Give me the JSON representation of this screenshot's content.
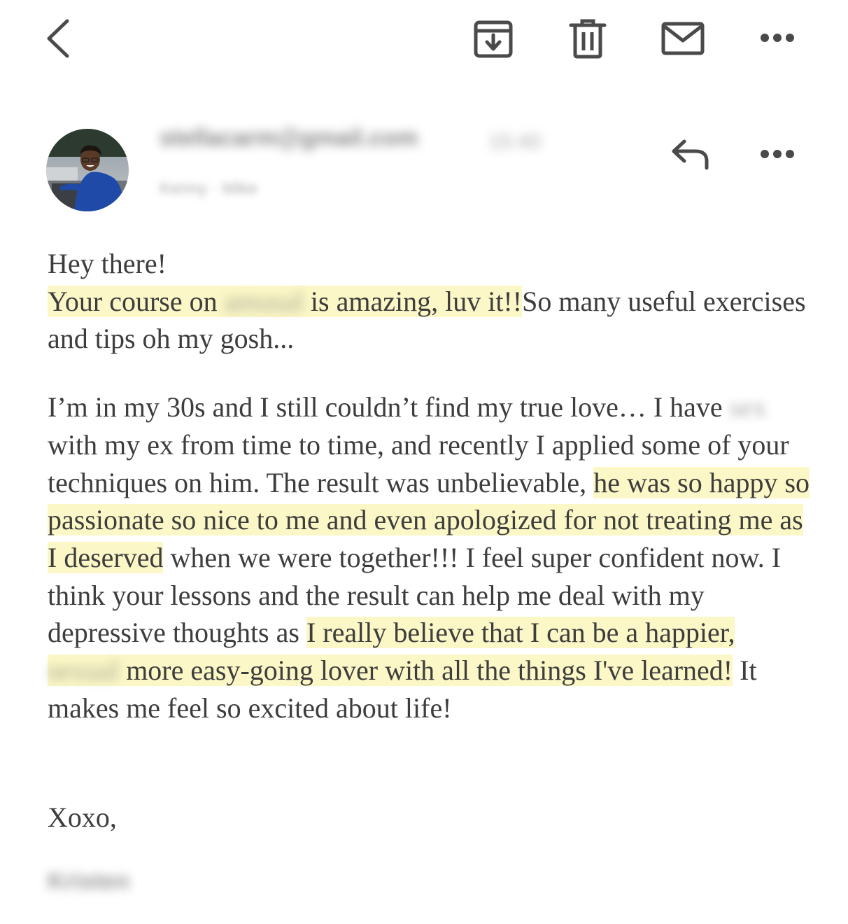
{
  "toolbar": {
    "back_icon": "chevron-left-icon",
    "archive_icon": "archive-download-icon",
    "delete_icon": "trash-icon",
    "mark_unread_icon": "mail-icon",
    "more_icon": "more-horizontal-icon"
  },
  "message": {
    "sender_email": "stellacarm@gmail.com",
    "time": "15:40",
    "recipient": "Kenny · Mike",
    "reply_icon": "reply-icon",
    "more_icon": "more-horizontal-icon"
  },
  "body": {
    "greeting": "Hey there!",
    "p1": {
      "hl_a": "Your course on",
      "redacted_a": "amusal",
      "hl_b": "is amazing, luv it!!",
      "rest": "So many useful exercises and tips oh my gosh..."
    },
    "p2": {
      "t1": "I’m in my 30s and I still couldn’t find my true love… I have",
      "redacted_b": "sex",
      "t2": "with my ex from time to time, and recently I applied some of your techniques on him. The result was unbelievable,",
      "hl_c": "he was so happy so passionate so nice to me and even apologized for not treating me as I deserved",
      "t3": "when we were together!!!  I feel super confident now. I think your lessons and the result can help me deal with my depressive thoughts as",
      "hl_d": "I really believe that I can be a happier,",
      "redacted_c": "sexual",
      "hl_e": "more easy-going lover with all the things I've learned!",
      "t4": "It makes me feel so excited about life!"
    },
    "signoff": "Xoxo,",
    "signature": "Kristen"
  },
  "colors": {
    "highlight": "#fbf7c6",
    "text": "#3d3d3d",
    "icon": "#4a4a4a"
  }
}
